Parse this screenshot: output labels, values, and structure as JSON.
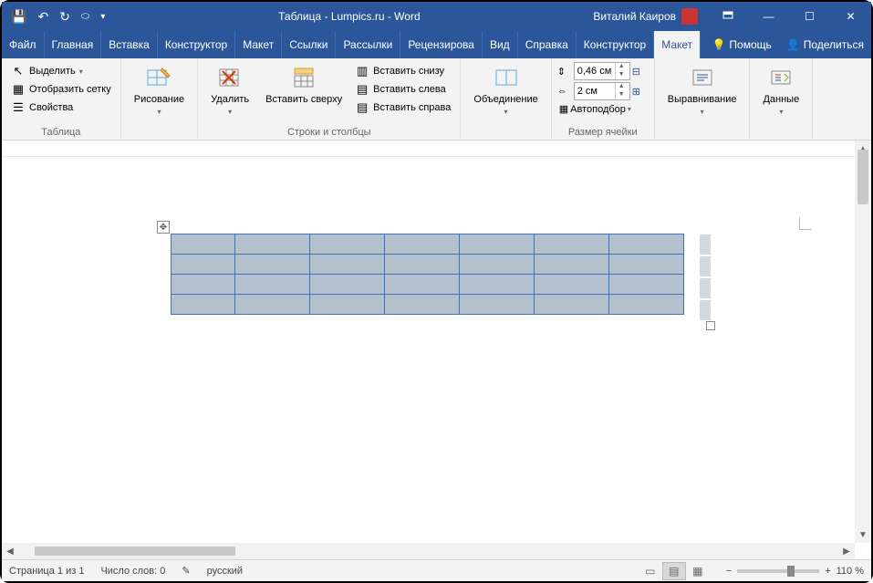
{
  "title": "Таблица - Lumpics.ru  -  Word",
  "user": "Виталий Каиров",
  "tabs": {
    "file": "Файл",
    "home": "Главная",
    "insert": "Вставка",
    "design": "Конструктор",
    "layout": "Макет",
    "refs": "Ссылки",
    "mail": "Рассылки",
    "review": "Рецензирова",
    "view": "Вид",
    "help": "Справка",
    "table_design": "Конструктор",
    "table_layout": "Макет",
    "tellme": "Помощь",
    "share": "Поделиться"
  },
  "ribbon": {
    "table_group": "Таблица",
    "select": "Выделить",
    "gridlines": "Отобразить сетку",
    "properties": "Свойства",
    "draw_group": "Рисование",
    "draw": "Рисование",
    "delete": "Удалить",
    "rows_cols_group": "Строки и столбцы",
    "insert_above": "Вставить сверху",
    "insert_below": "Вставить снизу",
    "insert_left": "Вставить слева",
    "insert_right": "Вставить справа",
    "merge_group": "Объединение",
    "merge": "Объединение",
    "cellsize_group": "Размер ячейки",
    "height": "0,46 см",
    "width": "2 см",
    "autofit": "Автоподбор",
    "align_group": "Выравнивание",
    "align": "Выравнивание",
    "data_group": "Данные",
    "data": "Данные"
  },
  "status": {
    "page": "Страница 1 из 1",
    "words": "Число слов: 0",
    "lang": "русский",
    "zoom": "110 %"
  },
  "table": {
    "rows": 4,
    "cols": 7
  }
}
